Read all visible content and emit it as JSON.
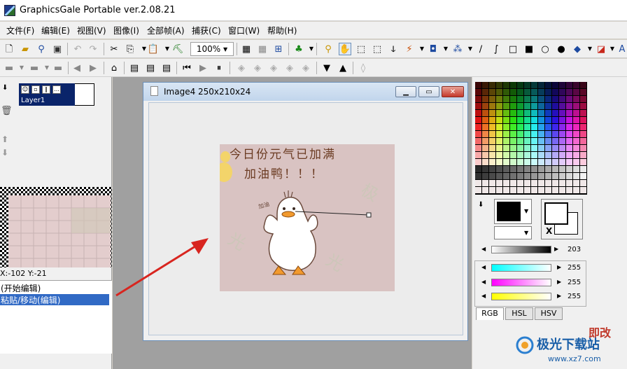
{
  "window": {
    "title": "GraphicsGale Portable ver.2.08.21"
  },
  "menu": [
    "文件(F)",
    "编辑(E)",
    "视图(V)",
    "图像(I)",
    "全部帧(A)",
    "捕获(C)",
    "窗口(W)",
    "帮助(H)"
  ],
  "toolbar": {
    "zoom": "100%"
  },
  "layers": {
    "name": "Layer1"
  },
  "status": {
    "coords": "X:-102 Y:-21"
  },
  "history": {
    "items": [
      "(开始编辑)",
      "粘贴/移动(编辑)"
    ],
    "selected_index": 1
  },
  "document": {
    "title": "Image4 250x210x24"
  },
  "image": {
    "line1": "今日份元气已加满",
    "line2": "加油鸭！！！",
    "doodle": "加油"
  },
  "color": {
    "brightness_value": "203",
    "c_value": "255",
    "m_value": "255",
    "y_value": "255",
    "swap_label": "X"
  },
  "tabs": [
    "RGB",
    "HSL",
    "HSV"
  ],
  "watermark": {
    "name": "极光下载站",
    "url": "www.xz7.com",
    "partial": "即改"
  },
  "colors": {
    "selection": "#0a246a",
    "history_highlight": "#316ac5",
    "arrow": "#d8251f"
  }
}
